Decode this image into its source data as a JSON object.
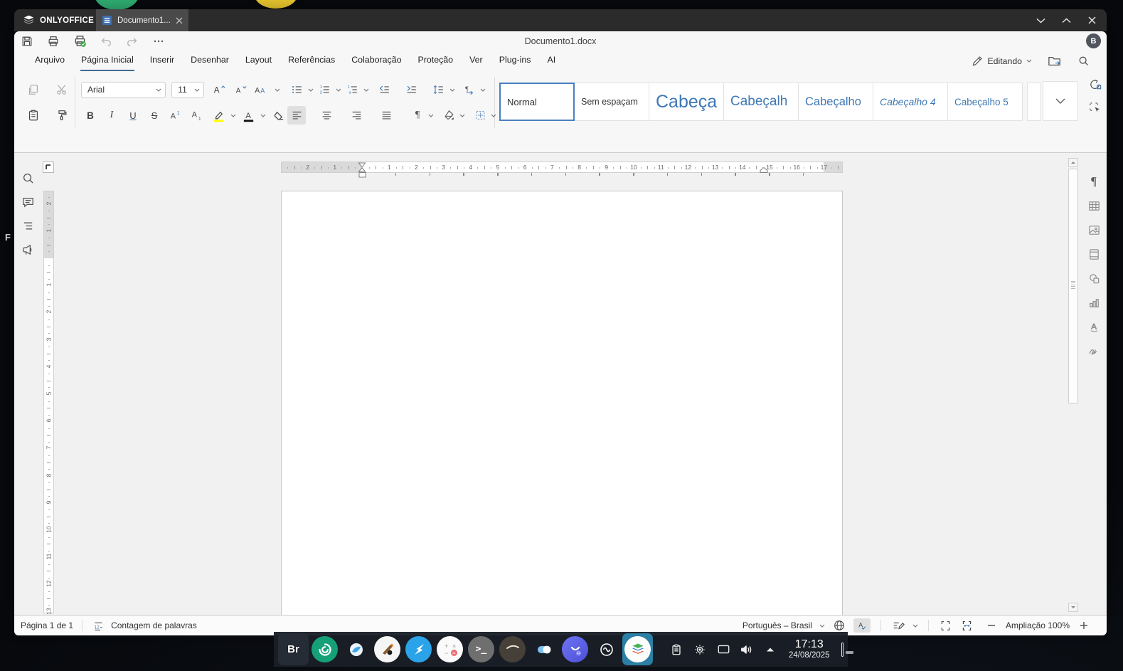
{
  "titlebar": {
    "brand": "ONLYOFFICE",
    "tab_title": "Documento1....",
    "controls": {
      "minimize": "minimize",
      "maximize": "maximize",
      "close": "close"
    }
  },
  "toolbar_top": {
    "title": "Documento1.docx",
    "avatar_initial": "B"
  },
  "menubar": {
    "items": [
      {
        "label": "Arquivo",
        "active": false
      },
      {
        "label": "Página Inicial",
        "active": true
      },
      {
        "label": "Inserir",
        "active": false
      },
      {
        "label": "Desenhar",
        "active": false
      },
      {
        "label": "Layout",
        "active": false
      },
      {
        "label": "Referências",
        "active": false
      },
      {
        "label": "Colaboração",
        "active": false
      },
      {
        "label": "Proteção",
        "active": false
      },
      {
        "label": "Ver",
        "active": false
      },
      {
        "label": "Plug-ins",
        "active": false
      },
      {
        "label": "AI",
        "active": false
      }
    ],
    "mode_label": "Editando"
  },
  "ribbon": {
    "font_name": "Arial",
    "font_size": "11",
    "styles": [
      {
        "label": "Normal",
        "variant": "normal",
        "selected": true
      },
      {
        "label": "Sem espaçam",
        "variant": "nospacing",
        "selected": false
      },
      {
        "label": "Cabeça",
        "variant": "h1",
        "selected": false
      },
      {
        "label": "Cabeçalh",
        "variant": "h2",
        "selected": false
      },
      {
        "label": "Cabeçalho",
        "variant": "h3",
        "selected": false
      },
      {
        "label": "Cabeçalho 4",
        "variant": "h4",
        "selected": false
      },
      {
        "label": "Cabeçalho 5",
        "variant": "h5",
        "selected": false
      }
    ]
  },
  "left_panel": {
    "icons": [
      "search",
      "comments",
      "headings",
      "feedback"
    ]
  },
  "right_panel": {
    "icons": [
      "paragraph-settings",
      "table-settings",
      "image-settings",
      "header-footer-settings",
      "shape-settings",
      "chart-settings",
      "text-art-settings",
      "signature-settings"
    ]
  },
  "rulers": {
    "h_margin_numbers": [
      "2",
      "1"
    ],
    "h_numbers": [
      "1",
      "2",
      "3",
      "4",
      "5",
      "6",
      "7",
      "8",
      "9",
      "10",
      "11",
      "12",
      "13",
      "14",
      "15",
      "16",
      "17"
    ],
    "v_margin_numbers": [
      "2",
      "1"
    ],
    "v_numbers": [
      "1",
      "2",
      "3",
      "4",
      "5",
      "6",
      "7",
      "8",
      "9",
      "10",
      "11",
      "12",
      "13"
    ]
  },
  "statusbar": {
    "page_label": "Página 1 de 1",
    "word_count_label": "Contagem de palavras",
    "language": "Português – Brasil",
    "zoom_label": "Ampliação 100%"
  },
  "taskbar": {
    "apps": [
      "br-browser",
      "chatgpt",
      "wolf-browser",
      "paint",
      "kite",
      "calculator",
      "terminal",
      "fedora",
      "settings-toggle",
      "assistant",
      "audio-wave",
      "onlyoffice"
    ],
    "active_app": "onlyoffice",
    "tray": [
      "clipboard",
      "brightness",
      "display",
      "volume",
      "tray-expand"
    ],
    "clock": {
      "time": "17:13",
      "date": "24/08/2025"
    }
  },
  "desktop": {
    "partial_icon_label": "F"
  },
  "colors": {
    "accent_blue": "#446995",
    "heading_blue": "#3e78b5",
    "highlight_yellow": "#ffff00",
    "taskbar_active_tile": "#2c7fa5",
    "quickprint_badge_green": "#3fae49"
  }
}
